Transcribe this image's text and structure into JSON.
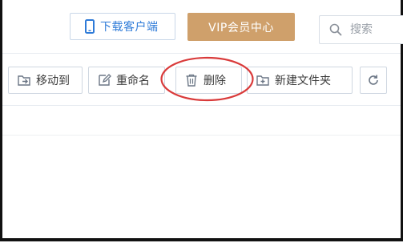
{
  "header": {
    "download_client_label": "下载客户端",
    "vip_center_label": "VIP会员中心",
    "search": {
      "placeholder": "搜索"
    }
  },
  "toolbar": {
    "move_to_label": "移动到",
    "rename_label": "重命名",
    "delete_label": "删除",
    "new_folder_label": "新建文件夹"
  },
  "colors": {
    "accent_blue": "#2e7bd8",
    "vip_gold": "#cfa06b",
    "highlight_red": "#d93a3a"
  },
  "icons": [
    "phone-icon",
    "search-icon",
    "move-icon",
    "edit-icon",
    "trash-icon",
    "new-folder-icon",
    "refresh-icon"
  ]
}
